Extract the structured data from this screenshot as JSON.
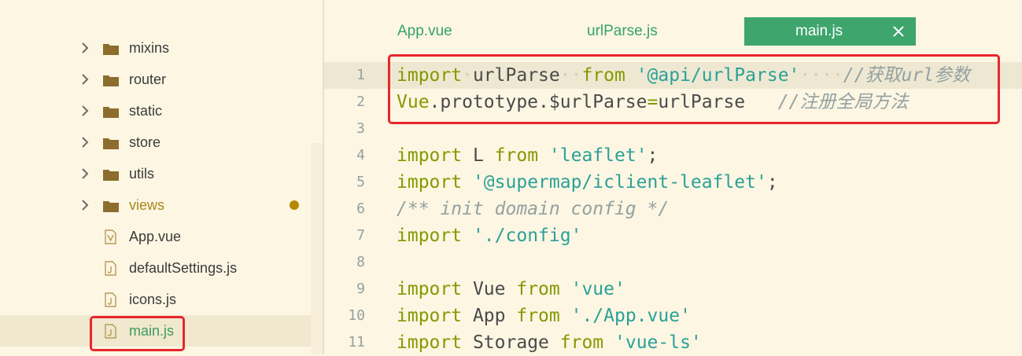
{
  "sidebar": {
    "items": [
      {
        "label": "mixins",
        "type": "folder"
      },
      {
        "label": "router",
        "type": "folder"
      },
      {
        "label": "static",
        "type": "folder"
      },
      {
        "label": "store",
        "type": "folder"
      },
      {
        "label": "utils",
        "type": "folder"
      },
      {
        "label": "views",
        "type": "folder",
        "modified": true
      },
      {
        "label": "App.vue",
        "type": "vue-file"
      },
      {
        "label": "defaultSettings.js",
        "type": "js-file"
      },
      {
        "label": "icons.js",
        "type": "js-file"
      },
      {
        "label": "main.js",
        "type": "js-file",
        "selected": true
      }
    ]
  },
  "tabs": [
    {
      "label": "App.vue"
    },
    {
      "label": "urlParse.js"
    },
    {
      "label": "main.js",
      "active": true
    }
  ],
  "editor": {
    "lines": [
      {
        "n": "1"
      },
      {
        "n": "2"
      },
      {
        "n": "3"
      },
      {
        "n": "4"
      },
      {
        "n": "5"
      },
      {
        "n": "6"
      },
      {
        "n": "7"
      },
      {
        "n": "8"
      },
      {
        "n": "9"
      },
      {
        "n": "10"
      },
      {
        "n": "11"
      }
    ],
    "tokens": {
      "l1": {
        "kw_import": "import",
        "name": "urlParse",
        "kw_from": "from",
        "str": "'@api/urlParse'",
        "comment": "//获取url参数"
      },
      "l2": {
        "obj": "Vue",
        "chain": ".prototype.$urlParse",
        "eq": "=",
        "val": "urlParse",
        "comment": "//注册全局方法"
      },
      "l4": {
        "kw_import": "import",
        "name": "L",
        "kw_from": "from",
        "str": "'leaflet'",
        "semi": ";"
      },
      "l5": {
        "kw_import": "import",
        "str": "'@supermap/iclient-leaflet'",
        "semi": ";"
      },
      "l6": {
        "comment": "/** init domain config */"
      },
      "l7": {
        "kw_import": "import",
        "str": "'./config'"
      },
      "l9": {
        "kw_import": "import",
        "name": "Vue",
        "kw_from": "from",
        "str": "'vue'"
      },
      "l10": {
        "kw_import": "import",
        "name": "App",
        "kw_from": "from",
        "str": "'./App.vue'"
      },
      "l11": {
        "kw_import": "import",
        "name": "Storage",
        "kw_from": "from",
        "str": "'vue-ls'"
      }
    }
  },
  "colors": {
    "background": "#fdf6e3",
    "accent_green": "#3ea56d",
    "keyword": "#859900",
    "string": "#2aa198",
    "comment": "#93a1a1",
    "annotation_red": "#e8262c",
    "modified_dot": "#b58900"
  },
  "icons": {
    "folder": "folder-icon",
    "chevron": "chevron-right-icon",
    "vue_file": "vue-file-icon",
    "js_file": "js-file-icon",
    "close": "close-icon"
  }
}
